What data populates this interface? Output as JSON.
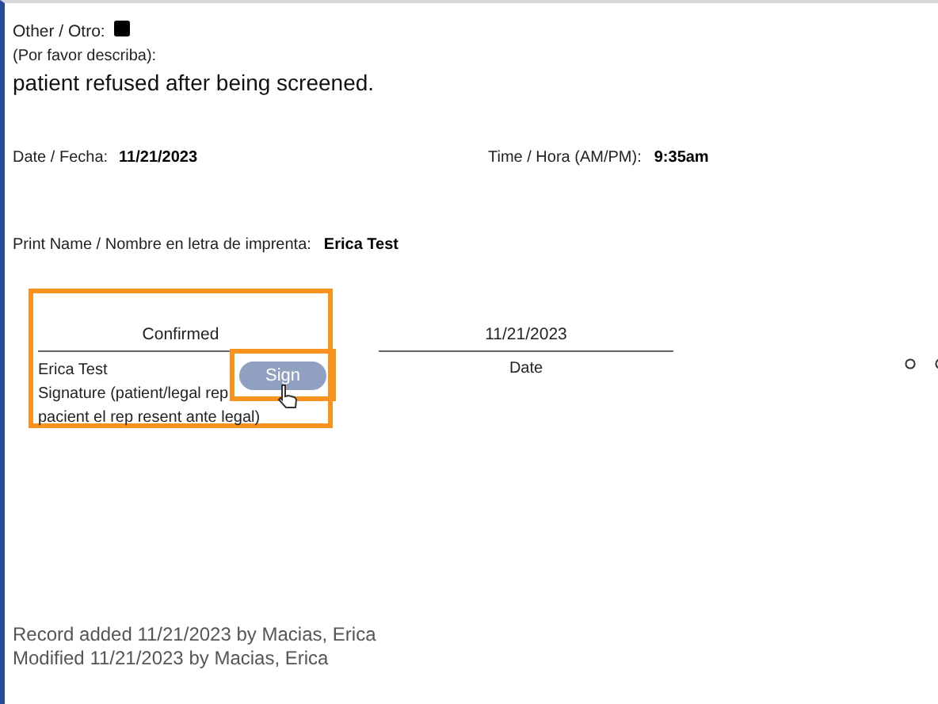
{
  "other": {
    "label": "Other / Otro:",
    "checked": true,
    "describe_label": "(Por favor describa):",
    "value": "patient refused after being screened."
  },
  "date": {
    "label": "Date / Fecha:",
    "value": "11/21/2023"
  },
  "time": {
    "label": "Time / Hora (AM/PM):",
    "value": "9:35am"
  },
  "print_name": {
    "label": "Print Name / Nombre en letra de imprenta:",
    "value": "Erica Test"
  },
  "signature": {
    "highlighted": true,
    "status": "Confirmed",
    "name": "Erica Test",
    "caption": "Signature (patient/legal rep",
    "caption_2": "pacient el rep resent ante legal)",
    "button": {
      "label": "Sign",
      "highlighted": true
    }
  },
  "signature_date": {
    "value": "11/21/2023",
    "caption": "Date"
  },
  "record": [
    "Record added 11/21/2023 by Macias, Erica",
    "Modified 11/21/2023 by Macias, Erica"
  ]
}
